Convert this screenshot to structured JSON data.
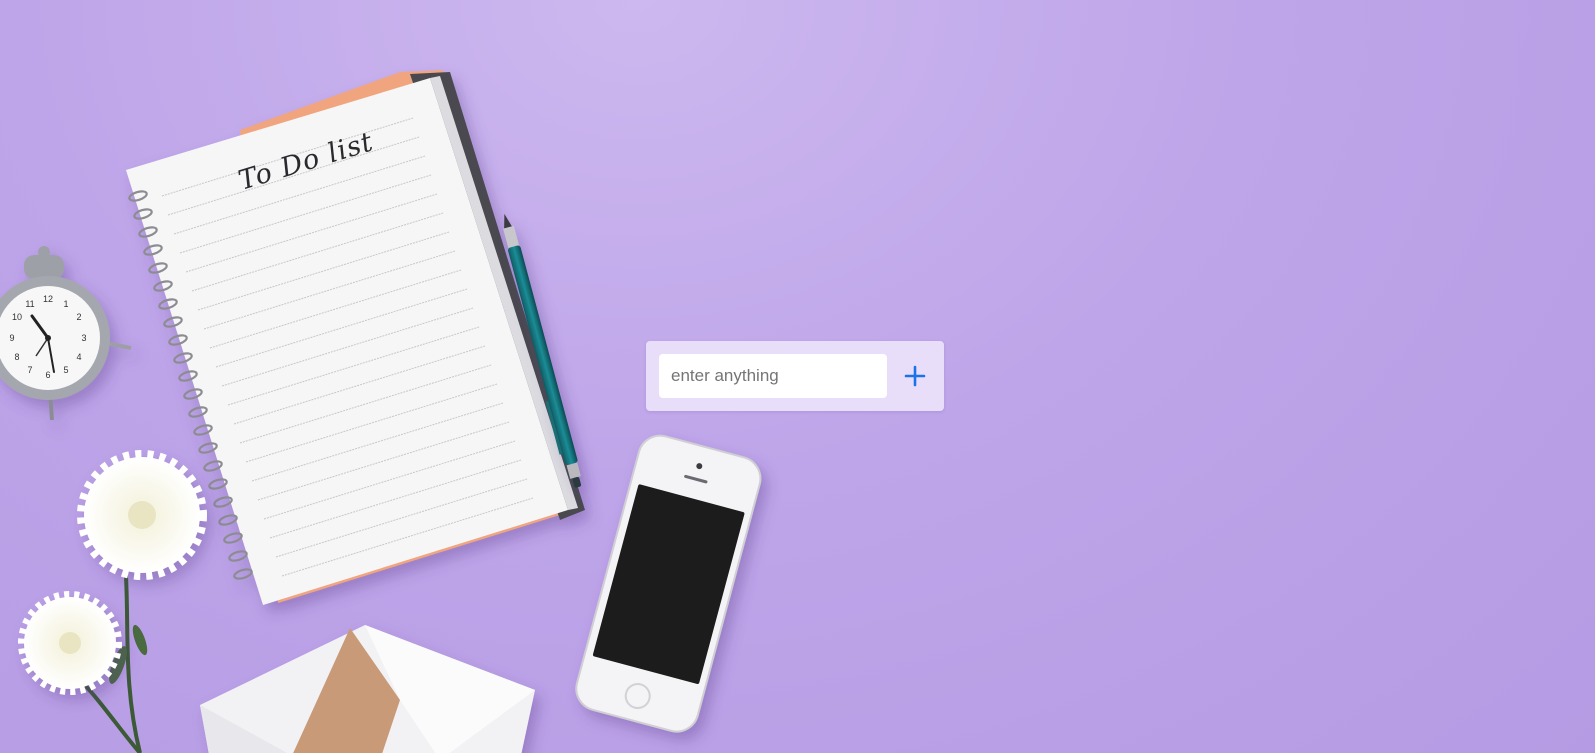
{
  "scene": {
    "notebook_title": "To Do list",
    "background_color": "#bfa7e8"
  },
  "todo_form": {
    "input_value": "",
    "input_placeholder": "enter anything",
    "add_icon": "plus-icon",
    "accent_color": "#1a73e8"
  }
}
